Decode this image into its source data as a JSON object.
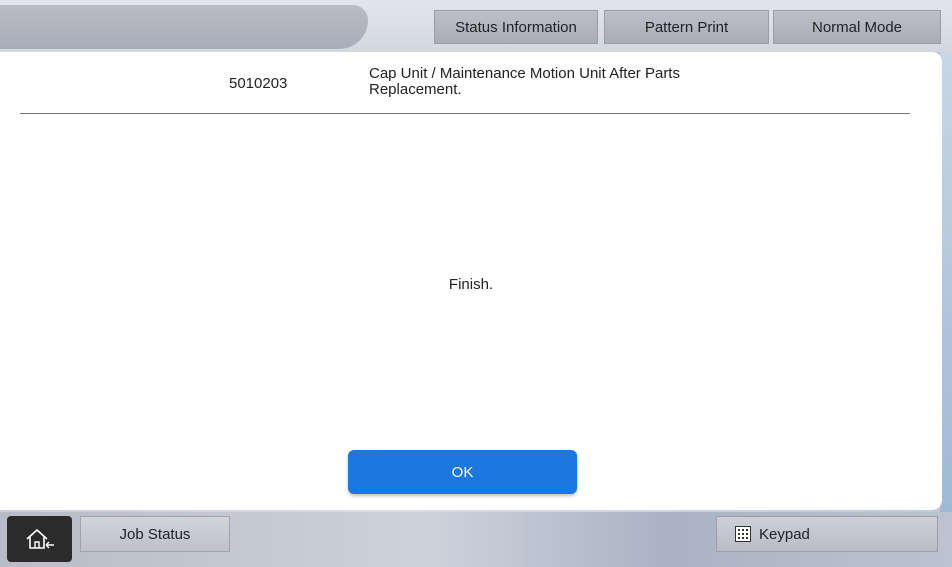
{
  "top_bar": {
    "status_information_label": "Status Information",
    "pattern_print_label": "Pattern Print",
    "normal_mode_label": "Normal Mode"
  },
  "panel": {
    "code": "5010203",
    "title": "Cap Unit / Maintenance Motion Unit After Parts Replacement.",
    "message": "Finish.",
    "ok_label": "OK"
  },
  "bottom_bar": {
    "home_icon": "home-icon",
    "job_status_label": "Job Status",
    "keypad_icon": "keypad-icon",
    "keypad_label": "Keypad"
  },
  "colors": {
    "ok_button": "#1a78e0",
    "panel_background": "#ffffff",
    "home_button": "#2b2b2b"
  }
}
